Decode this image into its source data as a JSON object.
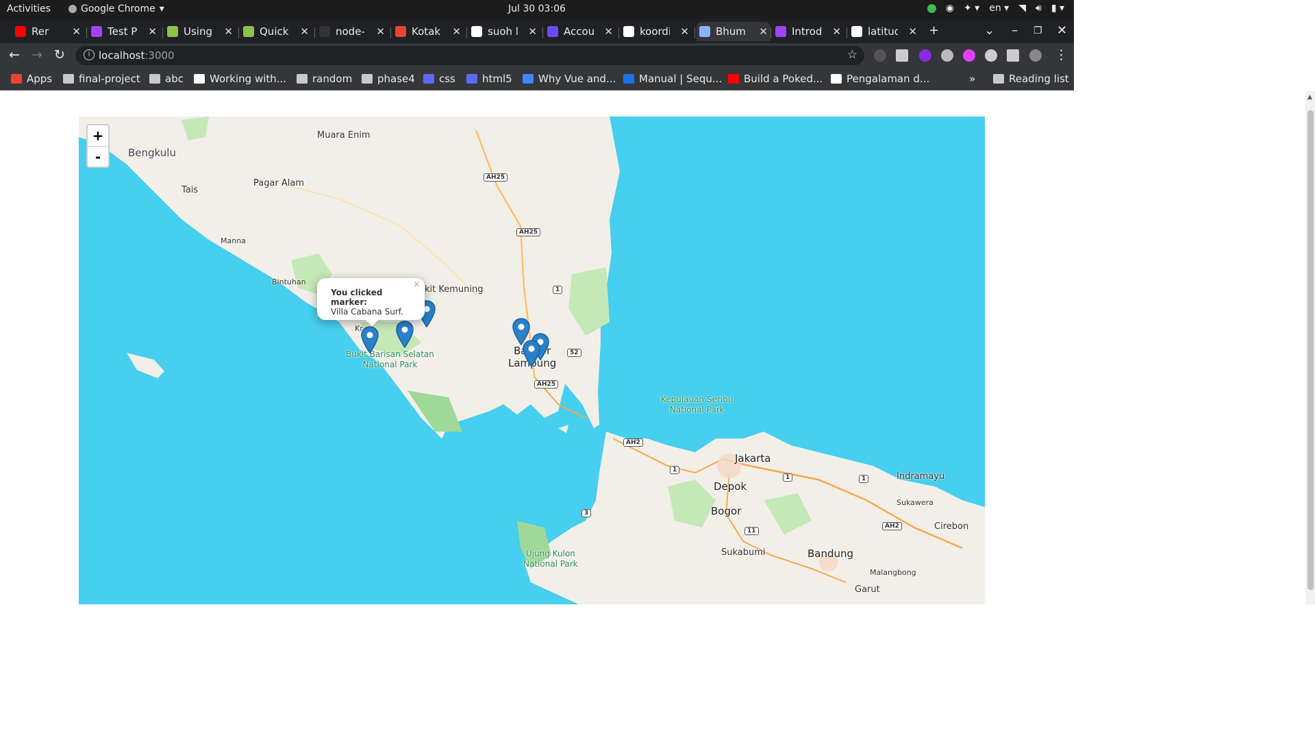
{
  "system": {
    "activities": "Activities",
    "app_name": "Google Chrome",
    "clock": "Jul 30  03:06",
    "lang": "en"
  },
  "tabs": [
    {
      "label": "Rer",
      "fav_color": "#ff0000"
    },
    {
      "label": "Test Pr",
      "fav_color": "#a142f4"
    },
    {
      "label": "Using (",
      "fav_color": "#8bc34a"
    },
    {
      "label": "Quick S",
      "fav_color": "#8bc34a"
    },
    {
      "label": "node-l",
      "fav_color": "#333333"
    },
    {
      "label": "Kotak",
      "fav_color": "#ea4335"
    },
    {
      "label": "suoh la",
      "fav_color": "#ffffff"
    },
    {
      "label": "Accour",
      "fav_color": "#6a4cff"
    },
    {
      "label": "koordi",
      "fav_color": "#ffffff"
    },
    {
      "label": "Bhumi",
      "fav_color": "#8ab4f8"
    },
    {
      "label": "Introd",
      "fav_color": "#a142f4"
    },
    {
      "label": "latitud",
      "fav_color": "#ffffff"
    }
  ],
  "toolbar": {
    "url_host": "localhost",
    "url_port": ":3000"
  },
  "bookmarks": [
    {
      "label": "Apps"
    },
    {
      "label": "final-project"
    },
    {
      "label": "abc"
    },
    {
      "label": "Working with..."
    },
    {
      "label": "random"
    },
    {
      "label": "phase4"
    },
    {
      "label": "css"
    },
    {
      "label": "html5"
    },
    {
      "label": "Why Vue and..."
    },
    {
      "label": "Manual | Sequ..."
    },
    {
      "label": "Build a Poked..."
    },
    {
      "label": "Pengalaman d..."
    },
    {
      "label": "Reading list"
    }
  ],
  "map": {
    "zoom_in": "+",
    "zoom_out": "-",
    "places": {
      "muara_enim": "Muara Enim",
      "bengkulu": "Bengkulu",
      "tais": "Tais",
      "pagar_alam": "Pagar Alam",
      "manna": "Manna",
      "bintuhan": "Bintuhan",
      "kit_kemuning": "kit Kemuning",
      "kr": "Kr",
      "bukit_barisan": "Bukit Barisan Selatan",
      "national_park": "National Park",
      "bandar_lampung_1": "Ba      r",
      "bandar_lampung_2": "Lampung",
      "kepulauan_seribu": "Kepulauan Seribu",
      "kepulauan_np": "National Park",
      "jakarta": "Jakarta",
      "depok": "Depok",
      "bogor": "Bogor",
      "indramayu": "Indramayu",
      "sukawera": "Sukawera",
      "cirebon": "Cirebon",
      "ujung_kulon": "Ujung Kulon",
      "ujung_np": "National Park",
      "sukabumi": "Sukabumi",
      "bandung": "Bandung",
      "malangbong": "Malangbong",
      "garut": "Garut"
    },
    "roads": {
      "r1": "AH25",
      "r2": "AH25",
      "r3": "1",
      "r4": "52",
      "r5": "AH25",
      "r6": "AH2",
      "r7": "1",
      "r8": "1",
      "r9": "1",
      "r10": "3",
      "r11": "11",
      "r12": "AH2"
    },
    "popup": {
      "title": "You clicked marker:",
      "text": "Villa Cabana Surf.",
      "close": "×"
    },
    "marker_color": "#2a81cb",
    "water_color": "#46cfee",
    "land_color": "#f2efe9"
  }
}
